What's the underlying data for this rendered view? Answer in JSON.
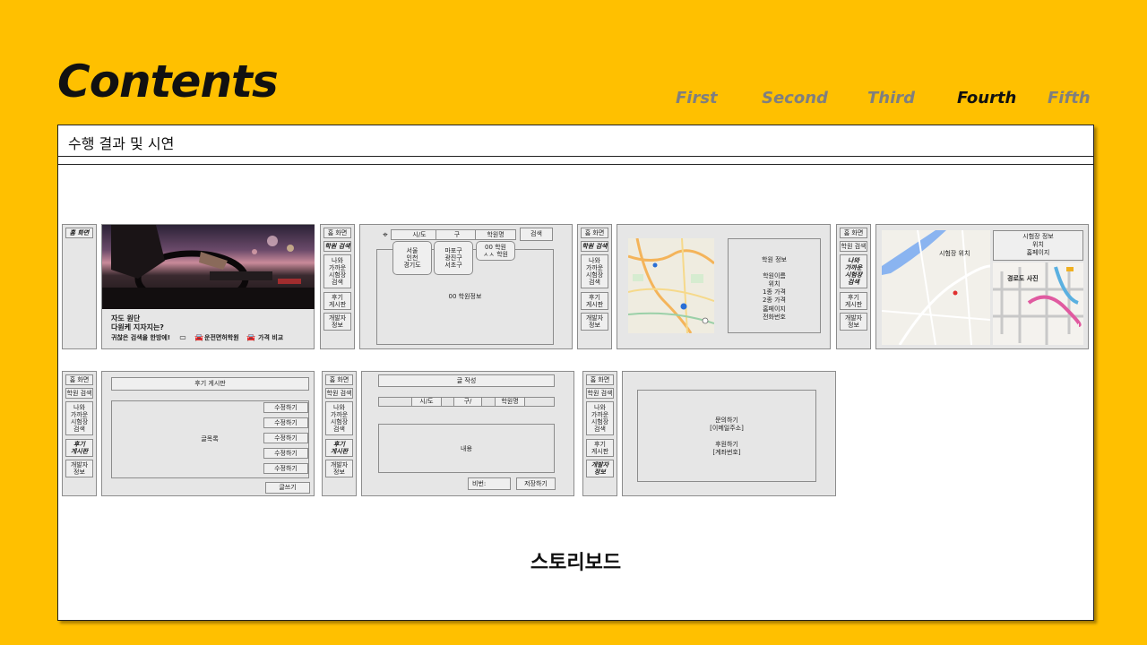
{
  "header": {
    "title": "Contents",
    "nav": [
      "First",
      "Second",
      "Third",
      "Fourth",
      "Fifth"
    ],
    "active_nav": "Fourth"
  },
  "card": {
    "heading": "수행 결과 및 시연",
    "caption": "스토리보드"
  },
  "sidebar": {
    "home": "홈 화면",
    "search": "학원 검색",
    "nearby": "나와\n가까운\n시험장\n검색",
    "reviews": "후기\n게시판",
    "dev": "개발자\n정보"
  },
  "screen_home": {
    "hero_line1": "자도 원단",
    "hero_line2": "다원케 지자지는?",
    "hero_line3": "귀찮은 검색을 한방에!",
    "hero_link1": "운전면허학원",
    "hero_link2": "가격 비교"
  },
  "screen_search": {
    "dropdown_city": "시/도",
    "dropdown_district": "구",
    "dropdown_academy": "학원명",
    "search_button": "검색",
    "city_options": "서울\n인천\n경기도",
    "district_options": "마포구\n광진구\n서초구",
    "academy_options": "00 학원\nㅅㅅ 학원",
    "result_text": "00 학원정보"
  },
  "screen_detail": {
    "info_text": "학원 정보\n\n학원이름\n위치\n1종 가격\n2종 가격\n홈페이지\n전화번호"
  },
  "screen_exam": {
    "map_label": "시험장 위치",
    "info_text": "시험장 정보\n위치\n홈페이지",
    "route_label": "경로도 사진"
  },
  "screen_board": {
    "title": "후기 게시판",
    "list_label": "글목록",
    "edit_button": "수정하기",
    "write_button": "글쓰기"
  },
  "screen_write": {
    "title": "글 작성",
    "city": "시/도",
    "district": "구/",
    "academy": "학원명",
    "content": "내용",
    "password": "비번:",
    "save_button": "저장하기"
  },
  "screen_dev": {
    "info_text": "문의하기\n[이메일주소]\n\n후원하기\n[계좌번호]"
  }
}
